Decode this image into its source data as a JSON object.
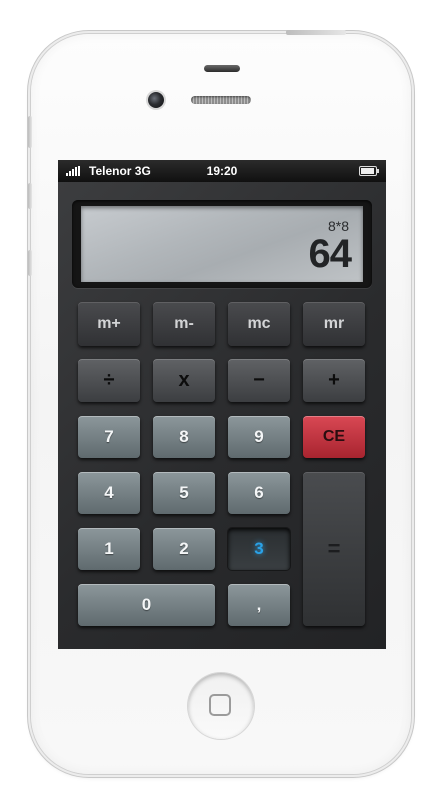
{
  "statusbar": {
    "carrier": "Telenor 3G",
    "time": "19:20",
    "signal_bars": 5,
    "battery_level": 0.9
  },
  "display": {
    "expression": "8*8",
    "result": "64"
  },
  "keys": {
    "m_plus": "m+",
    "m_minus": "m-",
    "mc": "mc",
    "mr": "mr",
    "divide": "÷",
    "multiply": "x",
    "subtract": "−",
    "add": "+",
    "seven": "7",
    "eight": "8",
    "nine": "9",
    "clear": "CE",
    "four": "4",
    "five": "5",
    "six": "6",
    "one": "1",
    "two": "2",
    "three": "3",
    "zero": "0",
    "comma": ",",
    "equals": "="
  },
  "colors": {
    "accent_active": "#2aa2e8",
    "clear_key": "#c93440",
    "number_key": "#7a8589",
    "display_bg": "#b4b9bd"
  },
  "icons": {
    "home_button": "home-square-icon",
    "signal": "signal-bars-icon",
    "battery": "battery-icon"
  }
}
